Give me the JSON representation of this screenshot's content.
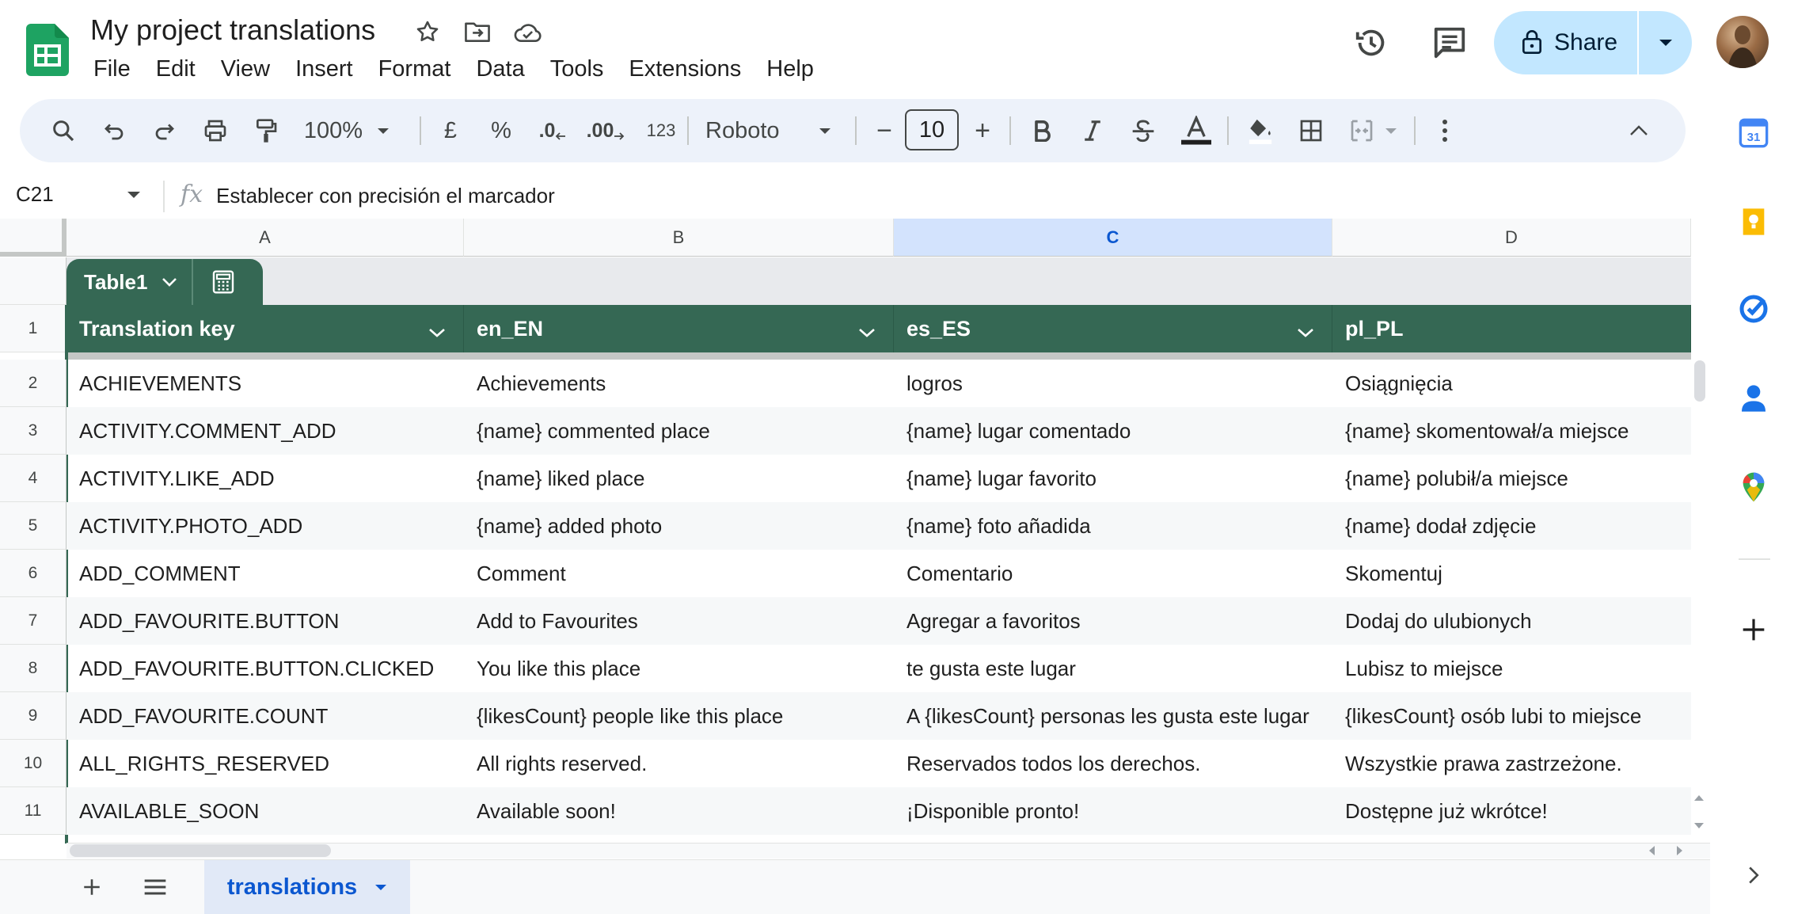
{
  "app": {
    "title": "My project translations",
    "icons": [
      "sheets-logo",
      "star-icon",
      "move-icon",
      "cloud-status-icon"
    ]
  },
  "menu": [
    "File",
    "Edit",
    "View",
    "Insert",
    "Format",
    "Data",
    "Tools",
    "Extensions",
    "Help"
  ],
  "header": {
    "share_label": "Share",
    "icons": [
      "history-icon",
      "comments-icon",
      "lock-icon",
      "avatar"
    ]
  },
  "toolbar": {
    "zoom": "100%",
    "currency": "£",
    "percent": "%",
    "decrease_decimal": ".0",
    "increase_decimal": ".00",
    "number_format": "123",
    "font": "Roboto",
    "font_size": "10",
    "minus": "−",
    "plus": "+"
  },
  "formula_bar": {
    "cell_ref": "C21",
    "fx": "fx",
    "content": "Establecer con precisión el marcador"
  },
  "columns": [
    "A",
    "B",
    "C",
    "D"
  ],
  "selected_column": "C",
  "table": {
    "name": "Table1",
    "headers": [
      "Translation key",
      "en_EN",
      "es_ES",
      "pl_PL"
    ],
    "rows": [
      {
        "num": "2",
        "cells": [
          "ACHIEVEMENTS",
          "Achievements",
          "logros",
          "Osiągnięcia"
        ]
      },
      {
        "num": "3",
        "cells": [
          "ACTIVITY.COMMENT_ADD",
          "{name} commented place",
          "{name} lugar comentado",
          "{name} skomentował/a miejsce"
        ]
      },
      {
        "num": "4",
        "cells": [
          "ACTIVITY.LIKE_ADD",
          "{name} liked place",
          "{name} lugar favorito",
          "{name} polubił/a miejsce"
        ]
      },
      {
        "num": "5",
        "cells": [
          "ACTIVITY.PHOTO_ADD",
          "{name} added photo",
          "{name} foto añadida",
          "{name} dodał zdjęcie"
        ]
      },
      {
        "num": "6",
        "cells": [
          "ADD_COMMENT",
          "Comment",
          "Comentario",
          "Skomentuj"
        ]
      },
      {
        "num": "7",
        "cells": [
          "ADD_FAVOURITE.BUTTON",
          "Add to Favourites",
          "Agregar a favoritos",
          "Dodaj do ulubionych"
        ]
      },
      {
        "num": "8",
        "cells": [
          "ADD_FAVOURITE.BUTTON.CLICKED",
          "You like this place",
          "te gusta este lugar",
          "Lubisz to miejsce"
        ]
      },
      {
        "num": "9",
        "cells": [
          "ADD_FAVOURITE.COUNT",
          "{likesCount} people like this place",
          "A {likesCount} personas les gusta este lugar",
          "{likesCount} osób lubi to miejsce"
        ]
      },
      {
        "num": "10",
        "cells": [
          "ALL_RIGHTS_RESERVED",
          "All rights reserved.",
          "Reservados todos los derechos.",
          "Wszystkie prawa zastrzeżone."
        ]
      },
      {
        "num": "11",
        "cells": [
          "AVAILABLE_SOON",
          "Available soon!",
          "¡Disponible pronto!",
          "Dostępne już wkrótce!"
        ]
      }
    ],
    "header_row_num": "1"
  },
  "sheets": {
    "active": "translations"
  },
  "side_panel": [
    "calendar-icon",
    "keep-icon",
    "tasks-icon",
    "contacts-icon",
    "maps-icon",
    "add-icon"
  ],
  "calendar_day": "31",
  "colors": {
    "table_header": "#356854",
    "selected_column": "#d3e3fd",
    "share_bg": "#c2e7ff",
    "accent_blue": "#0b57d0"
  }
}
